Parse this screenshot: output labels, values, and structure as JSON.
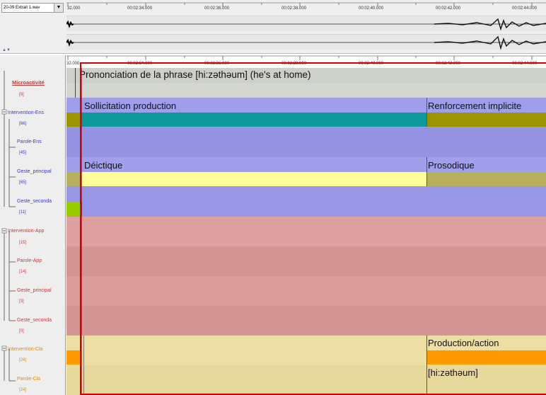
{
  "file_selector": {
    "value": "20-09 Extrait 1.wav"
  },
  "top_ruler": {
    "labels": [
      "32.000",
      "00:02:34.000",
      "00:02:36.000",
      "00:02:38.000",
      "00:02:40.000",
      "00:02:42.000",
      "00:02:44.000"
    ]
  },
  "bottom_ruler": {
    "labels": [
      "32.000",
      "00:02:34.000",
      "00:02:36.000",
      "00:02:38.000",
      "00:02:40.000",
      "00:02:42.000",
      "00:02:44.000"
    ]
  },
  "tiers": [
    {
      "name": "Microactivité",
      "count": "[9]"
    },
    {
      "name": "Intervention-Ens",
      "count": "[66]"
    },
    {
      "name": "Parole-Ens",
      "count": "[45]"
    },
    {
      "name": "Geste_principal",
      "count": "[65]"
    },
    {
      "name": "Geste_seconda",
      "count": "[11]"
    },
    {
      "name": "Intervention-App",
      "count": "[15]"
    },
    {
      "name": "Parole-App",
      "count": "[14]"
    },
    {
      "name": "Geste_principal",
      "count": "[3]"
    },
    {
      "name": "Geste_seconda",
      "count": "[0]"
    },
    {
      "name": "Intervention-Cla",
      "count": "[24]"
    },
    {
      "name": "Parole-Cla",
      "count": "[24]"
    }
  ],
  "annotations": {
    "microactivite": "Prononciation de la phrase  [hi:zəthəum] (he's at home)",
    "sollicitation": "Sollicitation production",
    "renforcement": "Renforcement implicite",
    "deictique": "Déictique",
    "prosodique": "Prosodique",
    "production_action": "Production/action",
    "hi_z": "[hi:zəthəum]"
  },
  "colors": {
    "microactivite_band": "#ccd0c8",
    "ens_band": "#9999e6",
    "app_band": "#d99a9a",
    "cla_band": "#eadca0",
    "teal": "#0e9a9a",
    "olive": "#999400",
    "light_yellow": "#ffff99",
    "khaki": "#b9b05e",
    "lime": "#99cc00",
    "orange": "#ff9900",
    "selection": "#cc0000"
  }
}
